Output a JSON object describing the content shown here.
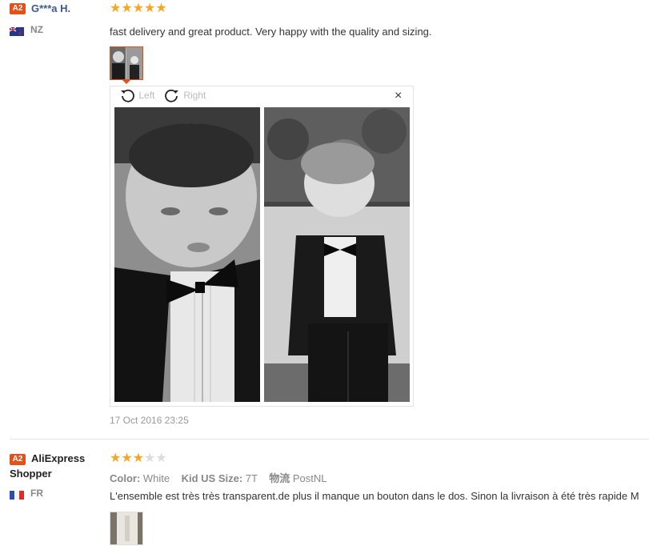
{
  "reviews": [
    {
      "badge": "A2",
      "name": "G***a H.",
      "country": "NZ",
      "rating": 5,
      "text": "fast delivery and great product. Very happy with the quality and sizing.",
      "date": "17 Oct 2016 23:25",
      "viewer": {
        "rotate_left_label": "Left",
        "rotate_right_label": "Right",
        "close_glyph": "×"
      }
    },
    {
      "badge": "A2",
      "name": "AliExpress Shopper",
      "country": "FR",
      "rating": 3,
      "attrs": {
        "color_label": "Color:",
        "color_value": "White",
        "size_label": "Kid US Size:",
        "size_value": "7T",
        "logistics_label": "物流",
        "logistics_value": "PostNL"
      },
      "text": "L'ensemble est très très transparent.de plus il manque un bouton dans le dos. Sinon la livraison à été très rapide M"
    }
  ],
  "colors": {
    "accent": "#e4501a",
    "star": "#f5a623",
    "name_link": "#3b5998"
  }
}
